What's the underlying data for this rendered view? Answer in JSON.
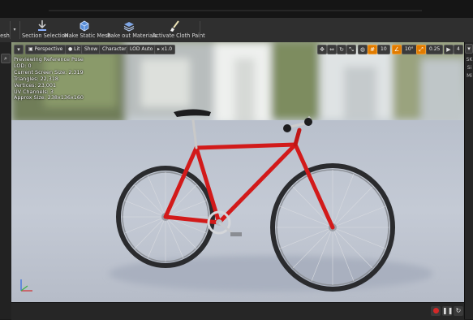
{
  "toolbar": {
    "cut_label": "esh",
    "items": [
      {
        "label": "Section Selection",
        "icon": "section-selection-icon"
      },
      {
        "label": "Make Static Mesh",
        "icon": "make-static-mesh-icon"
      },
      {
        "label": "Bake out Materials",
        "icon": "bake-materials-icon"
      },
      {
        "label": "Activate Cloth Paint",
        "icon": "cloth-paint-icon"
      }
    ]
  },
  "viewport": {
    "perspective_label": "Perspective",
    "lit_label": "Lit",
    "show_label": "Show",
    "character_label": "Character",
    "lod_label": "LOD Auto",
    "speed_label": "x1.0",
    "grid_snap": "10",
    "rotate_snap": "10°",
    "scale_snap": "0.25",
    "camera_speed": "4",
    "stats": [
      "Previewing Reference Pose",
      "LOD: 0",
      "Current Screen Size: 2.319",
      "Triangles: 22,318",
      "Vertices: 23,001",
      "UV Channels: 3",
      "Approx Size: 238x136x160"
    ]
  },
  "right_panel": {
    "items": [
      "SK",
      "Si",
      "Mi"
    ]
  },
  "colors": {
    "frame": "#d21a1a",
    "toolbar": "#2f2f2f",
    "accent": "#e07b00"
  }
}
